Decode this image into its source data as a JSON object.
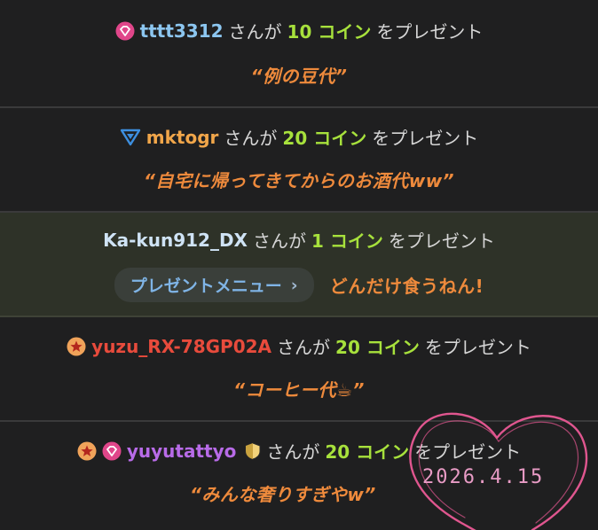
{
  "colors": {
    "background": "#1f1f20",
    "highlight_background": "#2e3228",
    "coin_green": "#a7e13c",
    "message_orange": "#ee8a3c",
    "heart_pink": "#e0568f"
  },
  "cards": [
    {
      "badges": [
        "diamond-badge-icon"
      ],
      "user": "tttt3312",
      "user_color": "#8cc6f0",
      "san_ga": "さんが",
      "coin_text": "10 コイン",
      "present_text": "をプレゼント",
      "message": "“例の豆代”"
    },
    {
      "badges": [
        "triangle-badge-icon"
      ],
      "user": "mktogr",
      "user_color": "#f1a64a",
      "san_ga": "さんが",
      "coin_text": "20 コイン",
      "present_text": "をプレゼント",
      "message": "“自宅に帰ってきてからのお酒代ww”"
    },
    {
      "badges": [],
      "user": "Ka-kun912_DX",
      "user_color": "#cfe3f5",
      "san_ga": "さんが",
      "coin_text": "1 コイン",
      "present_text": "をプレゼント",
      "menu_label": "プレゼントメニュー",
      "menu_chevron": "›",
      "message": "どんだけ食うねん!"
    },
    {
      "badges": [
        "star-badge-icon"
      ],
      "user": "yuzu_RX-78GP02A",
      "user_color": "#e84b3c",
      "san_ga": "さんが",
      "coin_text": "20 コイン",
      "present_text": "をプレゼント",
      "message": "“コーヒー代☕”"
    },
    {
      "badges": [
        "star-badge-icon",
        "diamond-badge-icon"
      ],
      "user": "yuyutattyo",
      "user_color": "#b86be8",
      "trailing_badge": "shield-badge-icon",
      "san_ga": "さんが",
      "coin_text": "20 コイン",
      "present_text": "をプレゼント",
      "message": "“みんな奢りすぎやw”"
    }
  ],
  "handwritten_date": "2026.4.15"
}
